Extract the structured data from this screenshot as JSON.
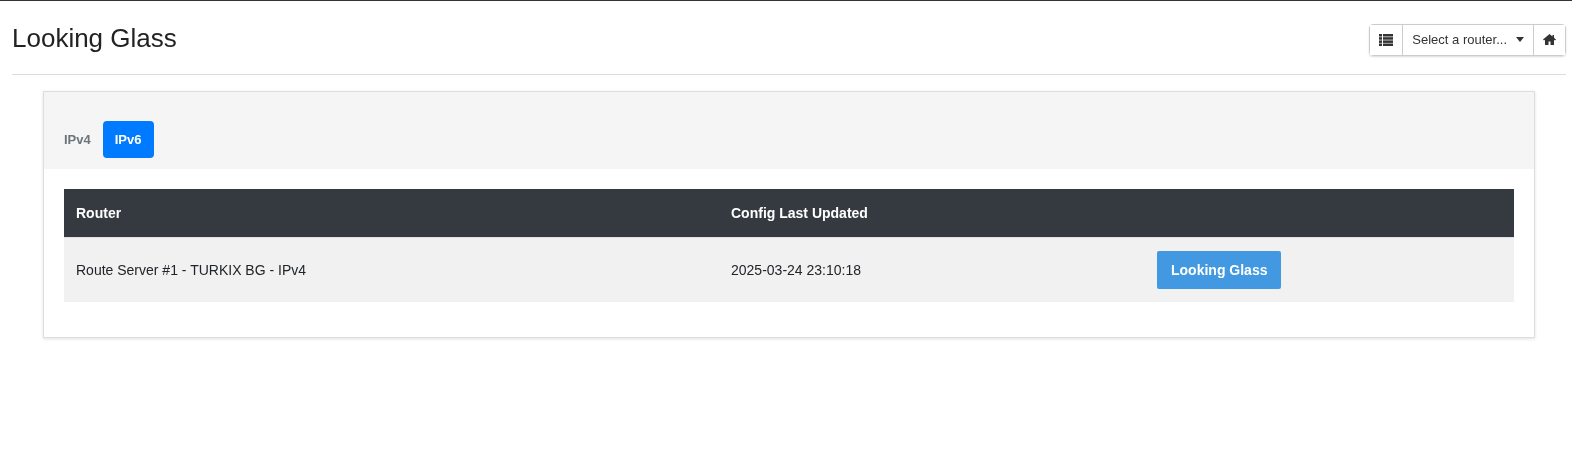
{
  "header": {
    "title": "Looking Glass",
    "router_select": {
      "label": "Select a router..."
    }
  },
  "tabs": [
    {
      "label": "IPv4",
      "selected": false
    },
    {
      "label": "IPv6",
      "selected": true
    }
  ],
  "table": {
    "columns": [
      "Router",
      "Config Last Updated"
    ],
    "rows": [
      {
        "router": "Route Server #1 - TURKIX BG - IPv4",
        "updated": "2025-03-24 23:10:18",
        "button": "Looking Glass"
      }
    ]
  }
}
